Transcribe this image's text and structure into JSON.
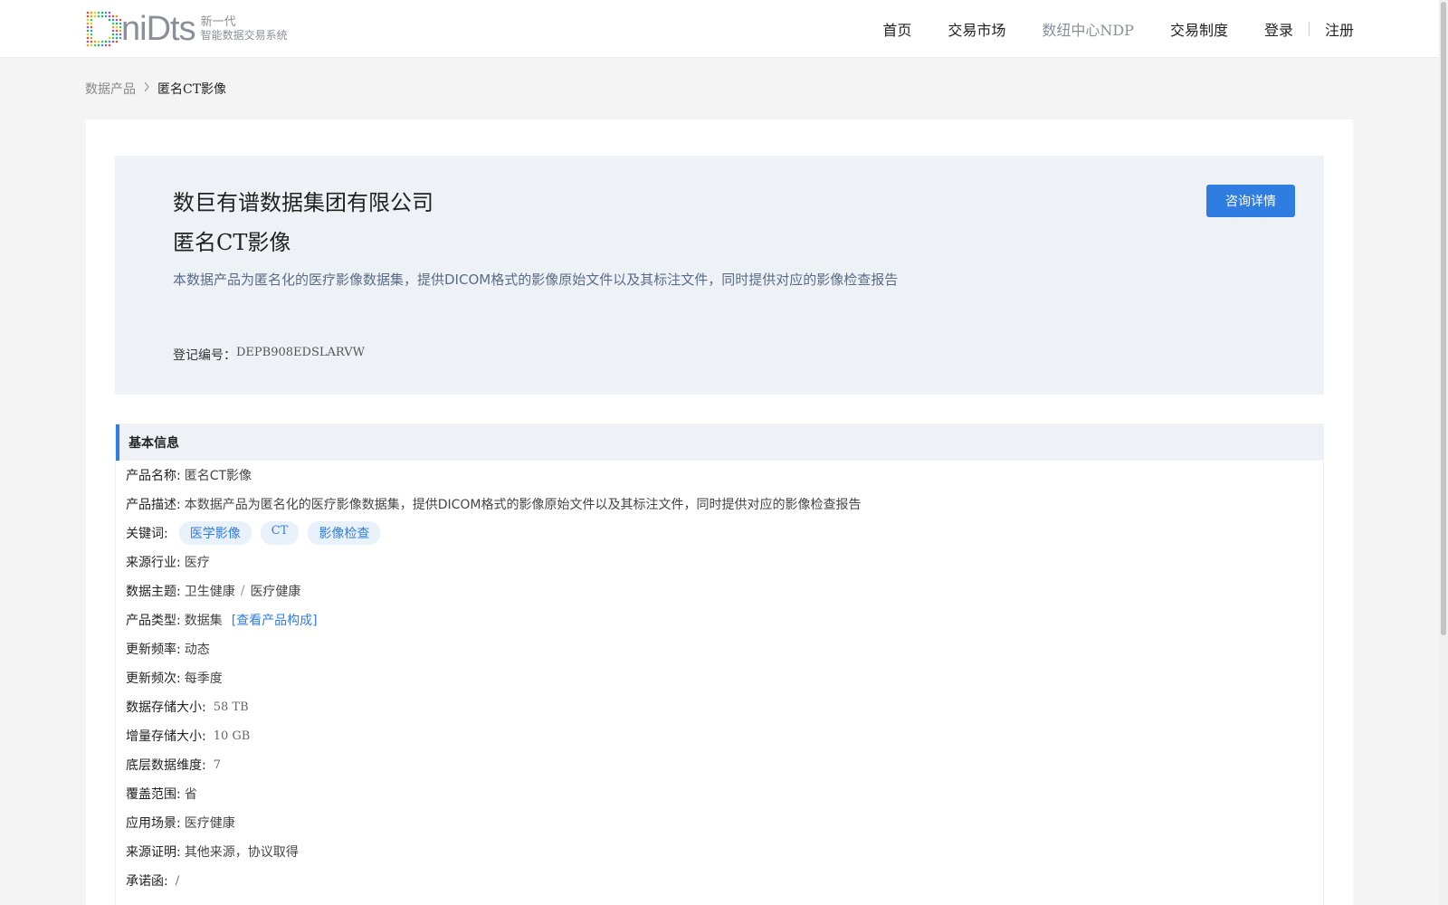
{
  "header": {
    "logo_text": "niDts",
    "logo_sub1": "新一代",
    "logo_sub2": "智能数据交易系统",
    "nav": [
      "首页",
      "交易市场",
      "数纽中心NDP",
      "交易制度"
    ],
    "login": "登录",
    "register": "注册"
  },
  "breadcrumb": {
    "parent": "数据产品",
    "current": "匿名CT影像"
  },
  "hero": {
    "company": "数巨有谱数据集团有限公司",
    "title": "匿名CT影像",
    "description": "本数据产品为匿名化的医疗影像数据集，提供DICOM格式的影像原始文件以及其标注文件，同时提供对应的影像检查报告",
    "reg_label": "登记编号：",
    "reg_value": "DEPB908EDSLARVW",
    "consult_button": "咨询详情"
  },
  "basic_info": {
    "heading": "基本信息",
    "product_name_label": "产品名称:",
    "product_name": "匿名CT影像",
    "product_desc_label": "产品描述:",
    "product_desc": "本数据产品为匿名化的医疗影像数据集，提供DICOM格式的影像原始文件以及其标注文件，同时提供对应的影像检查报告",
    "keywords_label": "关键词:",
    "keywords": [
      "医学影像",
      "CT",
      "影像检查"
    ],
    "industry_label": "来源行业:",
    "industry": "医疗",
    "theme_label": "数据主题:",
    "theme_1": "卫生健康",
    "theme_sep": "/",
    "theme_2": "医疗健康",
    "type_label": "产品类型:",
    "type": "数据集",
    "type_link": "[查看产品构成]",
    "freq_label": "更新频率:",
    "freq": "动态",
    "period_label": "更新频次:",
    "period": "每季度",
    "storage_label": "数据存储大小:",
    "storage": "58 TB",
    "incr_label": "增量存储大小:",
    "incr": "10 GB",
    "dims_label": "底层数据维度:",
    "dims": "7",
    "coverage_label": "覆盖范围:",
    "coverage": "省",
    "scenario_label": "应用场景:",
    "scenario": "医疗健康",
    "source_label": "来源证明:",
    "source": "其他来源，协议取得",
    "letter_label": "承诺函:",
    "letter": "/"
  }
}
